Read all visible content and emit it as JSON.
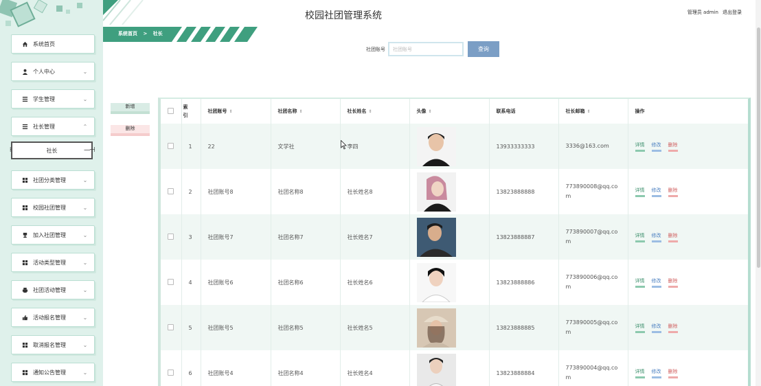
{
  "app": {
    "title": "校园社团管理系统"
  },
  "user": {
    "label": "管理员 admin",
    "logout": "退出登录"
  },
  "breadcrumb": {
    "home": "系统首页",
    "separator": ">",
    "current": "社长"
  },
  "sidebar": {
    "items": [
      {
        "label": "系统首页",
        "icon": "home-icon"
      },
      {
        "label": "个人中心",
        "icon": "user-icon"
      },
      {
        "label": "学生管理",
        "icon": "list-icon"
      },
      {
        "label": "社长管理",
        "icon": "list-icon"
      },
      {
        "label": "社团分类管理",
        "icon": "grid-icon"
      },
      {
        "label": "校园社团管理",
        "icon": "grid-icon"
      },
      {
        "label": "加入社团管理",
        "icon": "trophy-icon"
      },
      {
        "label": "活动类型管理",
        "icon": "grid-icon"
      },
      {
        "label": "社团活动管理",
        "icon": "printer-icon"
      },
      {
        "label": "活动报名管理",
        "icon": "thumb-icon"
      },
      {
        "label": "取消报名管理",
        "icon": "grid-icon"
      },
      {
        "label": "通知公告管理",
        "icon": "grid-icon"
      }
    ],
    "sub_item": "社长"
  },
  "search": {
    "label": "社团账号",
    "placeholder": "社团账号",
    "button": "查询"
  },
  "actions": {
    "add": "新增",
    "delete": "删除"
  },
  "table": {
    "headers": [
      "索引",
      "社团账号",
      "社团名称",
      "社长姓名",
      "头像",
      "联系电话",
      "社长邮箱",
      "操作"
    ],
    "index_header_line1": "索",
    "index_header_line2": "引",
    "rows": [
      {
        "index": "1",
        "account": "22",
        "name": "文学社",
        "leader": "李四",
        "phone": "13933333333",
        "email": "3336@163.com"
      },
      {
        "index": "2",
        "account": "社团账号8",
        "name": "社团名称8",
        "leader": "社长姓名8",
        "phone": "13823888888",
        "email": "773890008@qq.com"
      },
      {
        "index": "3",
        "account": "社团账号7",
        "name": "社团名称7",
        "leader": "社长姓名7",
        "phone": "13823888887",
        "email": "773890007@qq.com"
      },
      {
        "index": "4",
        "account": "社团账号6",
        "name": "社团名称6",
        "leader": "社长姓名6",
        "phone": "13823888886",
        "email": "773890006@qq.com"
      },
      {
        "index": "5",
        "account": "社团账号5",
        "name": "社团名称5",
        "leader": "社长姓名5",
        "phone": "13823888885",
        "email": "773890005@qq.com"
      },
      {
        "index": "6",
        "account": "社团账号4",
        "name": "社团名称4",
        "leader": "社长姓名4",
        "phone": "13823888884",
        "email": "773890004@qq.com"
      }
    ],
    "ops": {
      "detail": "详情",
      "edit": "修改",
      "delete": "删除"
    }
  },
  "colors": {
    "accent": "#3f9f7f",
    "sidebar_bg": "#dff1eb",
    "search_button": "#7b9ec5"
  }
}
